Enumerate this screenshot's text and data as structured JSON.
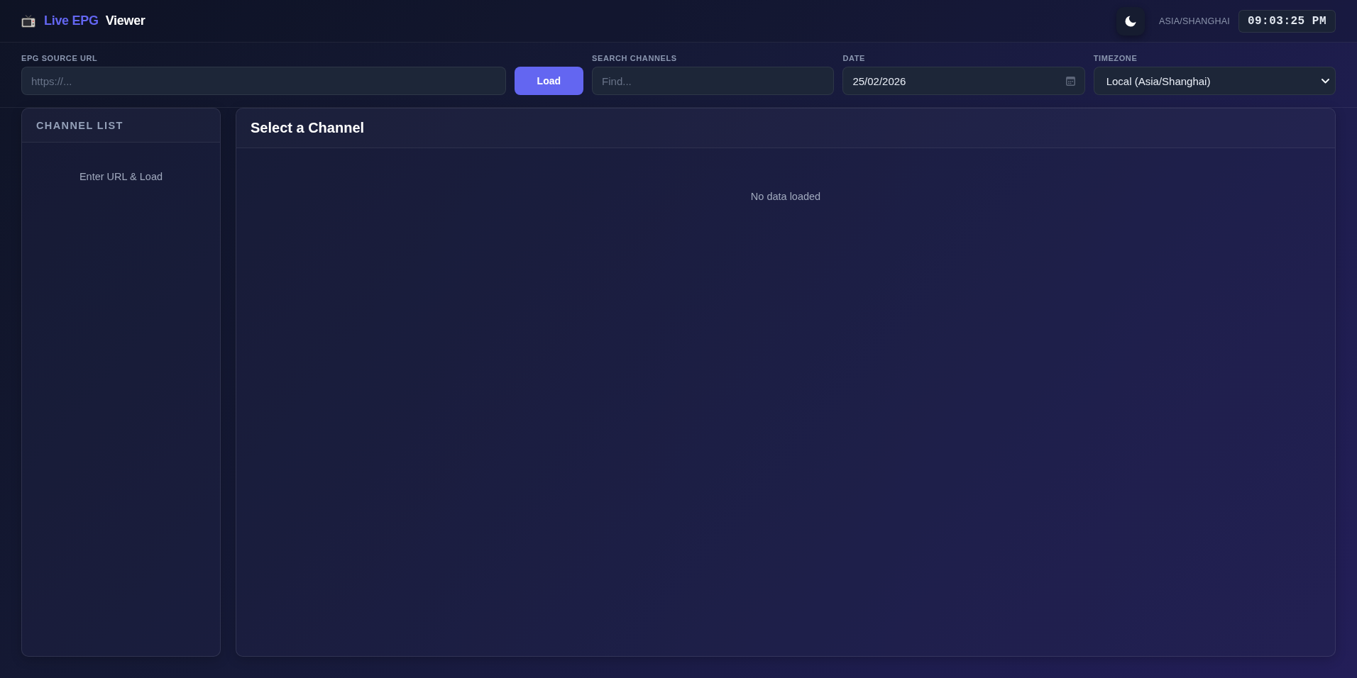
{
  "header": {
    "title_accent": "Live EPG",
    "title": "Viewer",
    "timezone": "ASIA/SHANGHAI",
    "clock": "09:03:25 PM"
  },
  "controls": [
    {
      "kind": "input",
      "label": "EPG SOURCE URL",
      "placeholder": "https://..."
    },
    {
      "kind": "button",
      "label": "Load"
    },
    {
      "kind": "input",
      "label": "SEARCH CHANNELS",
      "placeholder": "Find..."
    },
    {
      "kind": "date",
      "label": "DATE",
      "value": "25/02/2026"
    },
    {
      "kind": "select",
      "label": "TIMEZONE",
      "value": "Local (Asia/Shanghai)"
    }
  ],
  "channel_list": {
    "title": "CHANNEL LIST",
    "message": "Enter URL & Load"
  },
  "main_panel": {
    "title": "Select a Channel",
    "message": "No data loaded"
  }
}
